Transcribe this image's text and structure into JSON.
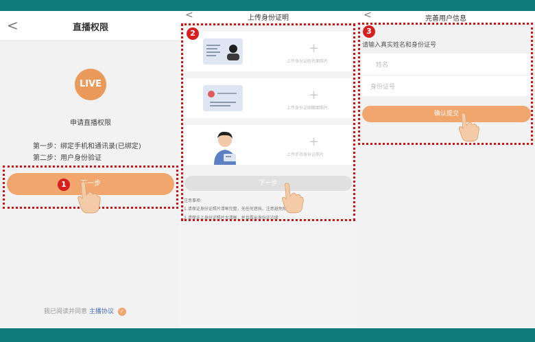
{
  "panel1": {
    "back": "<",
    "title": "直播权限",
    "live_badge": "LIVE",
    "apply_title": "申请直播权限",
    "step1": "第一步：绑定手机和通讯录(已绑定)",
    "step2": "第二步：用户身份验证",
    "next_button": "下一步",
    "agree_text": "我已阅读并同意",
    "agree_link": "主播协议",
    "marker": "1"
  },
  "panel2": {
    "back": "<",
    "title": "上传身份证明",
    "cards": [
      {
        "plus": "+",
        "label": "上传身份证姓名面照片"
      },
      {
        "plus": "+",
        "label": "上传身份证国徽面照片"
      },
      {
        "plus": "+",
        "label": "上传手持身份证照片"
      }
    ],
    "next_button": "下一步",
    "notice_title": "注意事项:",
    "notice_1": "1.请保证身份证照片清晰完整，无任何遮挡，注意避免照片反光；",
    "notice_2": "2.请保证上身份证照片大清晰，并且露出身份证边缘",
    "marker": "2"
  },
  "panel3": {
    "back": "<",
    "title": "完善用户信息",
    "hint": "请输入真实姓名和身份证号",
    "name_placeholder": "姓名",
    "id_placeholder": "身份证号",
    "confirm_button": "确认提交",
    "marker": "3"
  },
  "colors": {
    "accent": "#f0a66c",
    "marker": "#d62020",
    "frame": "#0f7a7a"
  }
}
